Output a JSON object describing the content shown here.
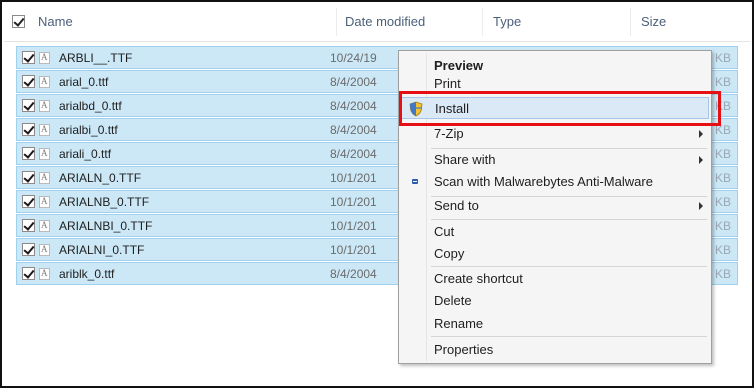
{
  "header": {
    "columns": [
      "Name",
      "Date modified",
      "Type",
      "Size"
    ]
  },
  "files": [
    {
      "name": "ARBLI__.TTF",
      "date": "10/24/19",
      "size": "KB"
    },
    {
      "name": "arial_0.ttf",
      "date": "8/4/2004",
      "size": "KB"
    },
    {
      "name": "arialbd_0.ttf",
      "date": "8/4/2004",
      "size": "KB"
    },
    {
      "name": "arialbi_0.ttf",
      "date": "8/4/2004",
      "size": "KB"
    },
    {
      "name": "ariali_0.ttf",
      "date": "8/4/2004",
      "size": "KB"
    },
    {
      "name": "ARIALN_0.TTF",
      "date": "10/1/201",
      "size": "KB"
    },
    {
      "name": "ARIALNB_0.TTF",
      "date": "10/1/201",
      "size": "KB"
    },
    {
      "name": "ARIALNBI_0.TTF",
      "date": "10/1/201",
      "size": "KB"
    },
    {
      "name": "ARIALNI_0.TTF",
      "date": "10/1/201",
      "size": "KB"
    },
    {
      "name": "ariblk_0.ttf",
      "date": "8/4/2004",
      "size": "KB"
    }
  ],
  "context_menu": {
    "preview": "Preview",
    "print": "Print",
    "install": "Install",
    "zip": "7-Zip",
    "share_with": "Share with",
    "scan": "Scan with Malwarebytes Anti-Malware",
    "send_to": "Send to",
    "cut": "Cut",
    "copy": "Copy",
    "create_shortcut": "Create shortcut",
    "delete": "Delete",
    "rename": "Rename",
    "properties": "Properties"
  },
  "colors": {
    "selection": "#cce8f7",
    "highlight_box": "#e60f14",
    "menu_bg": "#f5f5f5"
  }
}
